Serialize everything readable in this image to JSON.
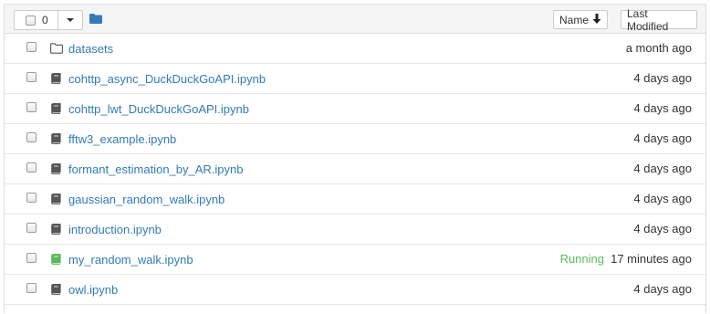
{
  "toolbar": {
    "selected_count": "0",
    "sort_name_label": "Name",
    "last_modified_label": "Last Modified"
  },
  "colors": {
    "link": "#337ab7",
    "running": "#5cb85c",
    "folder_icon": "#337ab7",
    "notebook_icon": "#555555",
    "running_notebook_icon": "#5cb85c"
  },
  "items": [
    {
      "type": "folder",
      "icon": "folder-icon",
      "name": "datasets",
      "status": "",
      "modified": "a month ago"
    },
    {
      "type": "notebook",
      "icon": "notebook-icon",
      "name": "cohttp_async_DuckDuckGoAPI.ipynb",
      "status": "",
      "modified": "4 days ago"
    },
    {
      "type": "notebook",
      "icon": "notebook-icon",
      "name": "cohttp_lwt_DuckDuckGoAPI.ipynb",
      "status": "",
      "modified": "4 days ago"
    },
    {
      "type": "notebook",
      "icon": "notebook-icon",
      "name": "fftw3_example.ipynb",
      "status": "",
      "modified": "4 days ago"
    },
    {
      "type": "notebook",
      "icon": "notebook-icon",
      "name": "formant_estimation_by_AR.ipynb",
      "status": "",
      "modified": "4 days ago"
    },
    {
      "type": "notebook",
      "icon": "notebook-icon",
      "name": "gaussian_random_walk.ipynb",
      "status": "",
      "modified": "4 days ago"
    },
    {
      "type": "notebook",
      "icon": "notebook-icon",
      "name": "introduction.ipynb",
      "status": "",
      "modified": "4 days ago"
    },
    {
      "type": "notebook-running",
      "icon": "notebook-icon",
      "name": "my_random_walk.ipynb",
      "status": "Running",
      "modified": "17 minutes ago"
    },
    {
      "type": "notebook",
      "icon": "notebook-icon",
      "name": "owl.ipynb",
      "status": "",
      "modified": "4 days ago"
    }
  ]
}
